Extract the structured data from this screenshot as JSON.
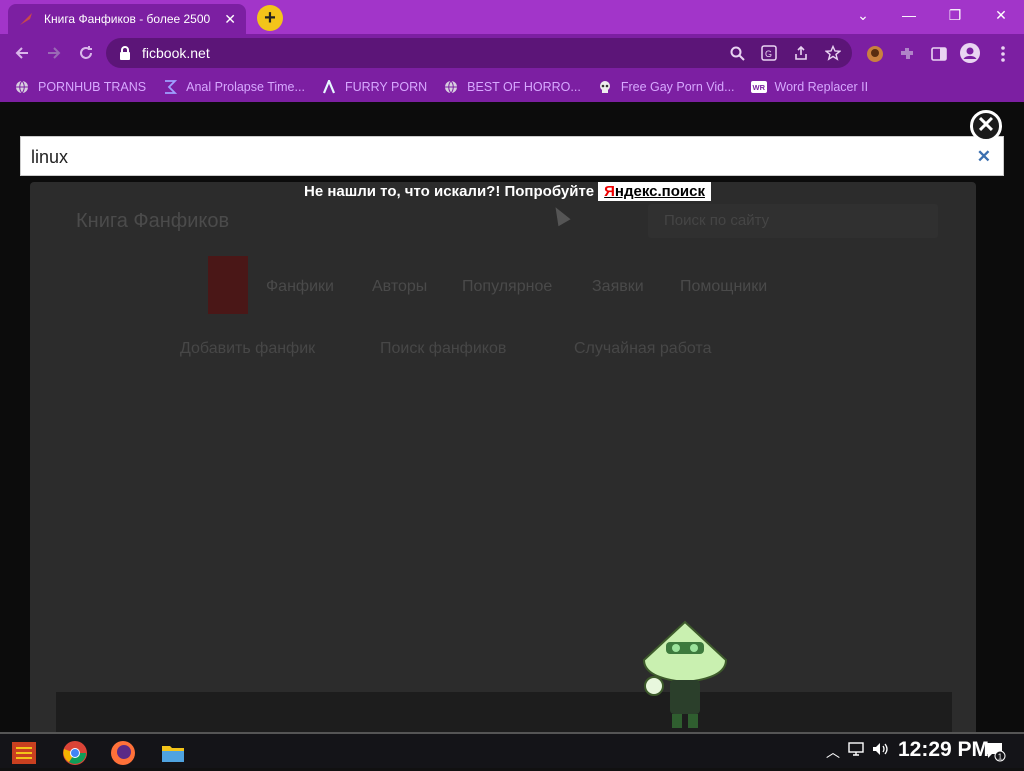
{
  "browser": {
    "tab": {
      "title": "Книга Фанфиков - более 2500",
      "close": "✕"
    },
    "new_tab": "+",
    "window_controls": {
      "dropdown": "⌄",
      "minimize": "—",
      "restore": "❐",
      "close": "✕"
    },
    "url": "ficbook.net",
    "bookmarks": [
      {
        "label": "PORNHUB TRANS",
        "icon": "globe-icon"
      },
      {
        "label": "Anal Prolapse Time...",
        "icon": "sigma-icon"
      },
      {
        "label": "FURRY PORN",
        "icon": "lambda-icon"
      },
      {
        "label": "BEST OF HORRO...",
        "icon": "globe-icon"
      },
      {
        "label": "Free Gay Porn Vid...",
        "icon": "skull-icon"
      },
      {
        "label": "Word Replacer II",
        "icon": "wr-icon"
      }
    ]
  },
  "overlay": {
    "search_value": "linux",
    "clear": "✕",
    "close": "✕",
    "hint_text": "Не нашли то, что искали?! Попробуйте",
    "yandex_first": "Я",
    "yandex_rest": "ндекс.поиск"
  },
  "site": {
    "logo": "Книга Фанфиков",
    "search_placeholder": "Поиск по сайту",
    "nav": [
      "Фанфики",
      "Авторы",
      "Популярное",
      "Заявки",
      "Помощники"
    ],
    "sub": [
      "Добавить фанфик",
      "Поиск фанфиков",
      "Случайная работа"
    ]
  },
  "taskbar": {
    "clock": "12:29 PM",
    "notifications": "1"
  },
  "colors": {
    "chrome_purple": "#7c1fa2",
    "tab_strip": "#a235c9",
    "bookmark_text": "#d7a8ff",
    "yandex_red": "#ee0000"
  }
}
